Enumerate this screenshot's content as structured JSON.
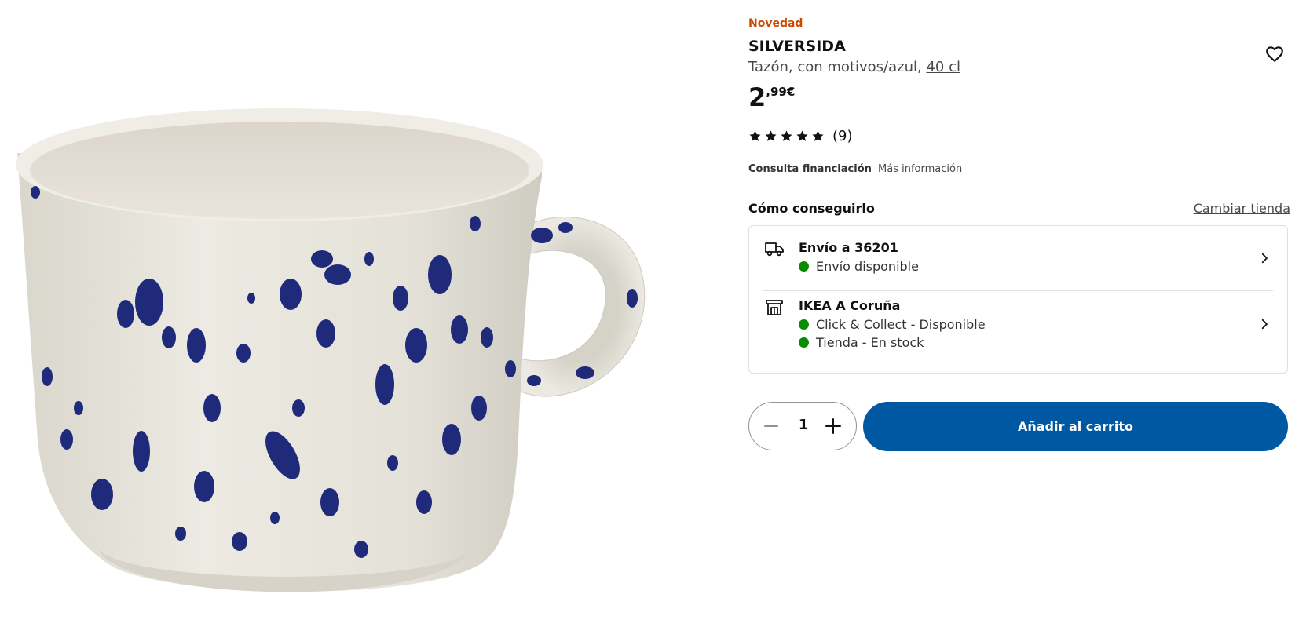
{
  "product": {
    "badge": "Novedad",
    "name": "SILVERSIDA",
    "description": "Tazón, con motivos/azul, ",
    "size": "40 cl",
    "price_integer": "2",
    "price_decimal": ",99€",
    "rating": 5,
    "review_count": "(9)",
    "image_icon": "mug-photo"
  },
  "finance": {
    "label": "Consulta financiación",
    "link": "Más información"
  },
  "availability": {
    "heading": "Cómo conseguirlo",
    "change_store": "Cambiar tienda",
    "delivery": {
      "icon": "truck-icon",
      "title": "Envío a 36201",
      "status": "Envío disponible"
    },
    "store": {
      "icon": "store-icon",
      "title": "IKEA A Coruña",
      "status_1": "Click & Collect - Disponible",
      "status_2": "Tienda - En stock"
    },
    "status_color": "#0a8a00"
  },
  "purchase": {
    "quantity": "1",
    "add_to_cart": "Añadir al carrito",
    "button_color": "#0058a3"
  },
  "colors": {
    "badge": "#cc4a00",
    "accent": "#0058a3"
  }
}
